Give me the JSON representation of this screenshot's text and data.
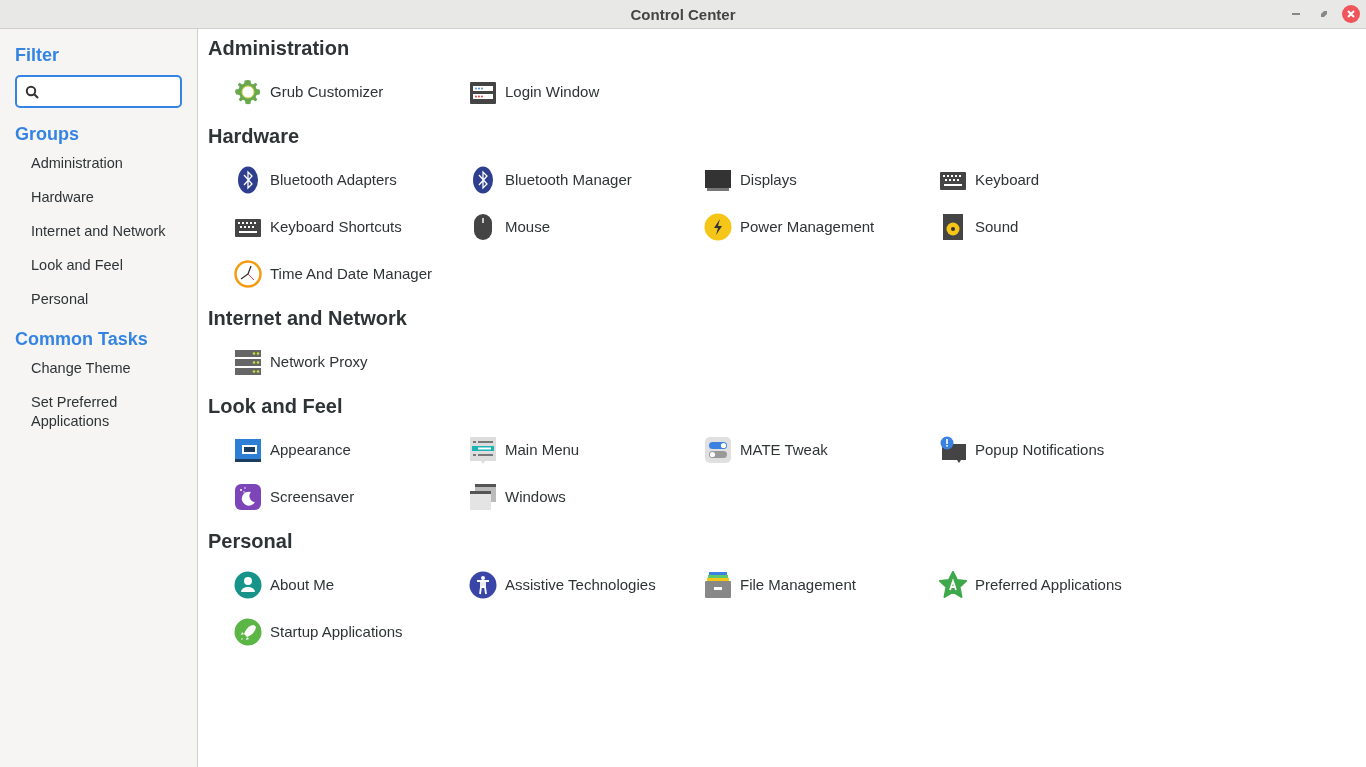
{
  "window": {
    "title": "Control Center"
  },
  "sidebar": {
    "filter_heading": "Filter",
    "groups_heading": "Groups",
    "groups": [
      "Administration",
      "Hardware",
      "Internet and Network",
      "Look and Feel",
      "Personal"
    ],
    "tasks_heading": "Common Tasks",
    "tasks": [
      "Change Theme",
      "Set Preferred Applications"
    ]
  },
  "sections": [
    {
      "title": "Administration",
      "items": [
        {
          "label": "Grub Customizer",
          "kind": "gear"
        },
        {
          "label": "Login Window",
          "kind": "login"
        }
      ]
    },
    {
      "title": "Hardware",
      "items": [
        {
          "label": "Bluetooth Adapters",
          "kind": "bluetooth"
        },
        {
          "label": "Bluetooth Manager",
          "kind": "bluetooth"
        },
        {
          "label": "Displays",
          "kind": "monitor"
        },
        {
          "label": "Keyboard",
          "kind": "keyboard"
        },
        {
          "label": "Keyboard Shortcuts",
          "kind": "keyboard"
        },
        {
          "label": "Mouse",
          "kind": "mouse"
        },
        {
          "label": "Power Management",
          "kind": "power"
        },
        {
          "label": "Sound",
          "kind": "speaker"
        },
        {
          "label": "Time And Date Manager",
          "kind": "clock"
        }
      ]
    },
    {
      "title": "Internet and Network",
      "items": [
        {
          "label": "Network Proxy",
          "kind": "server"
        }
      ]
    },
    {
      "title": "Look and Feel",
      "items": [
        {
          "label": "Appearance",
          "kind": "appearance"
        },
        {
          "label": "Main Menu",
          "kind": "menu"
        },
        {
          "label": "MATE Tweak",
          "kind": "toggles"
        },
        {
          "label": "Popup Notifications",
          "kind": "notification"
        },
        {
          "label": "Screensaver",
          "kind": "moon"
        },
        {
          "label": "Windows",
          "kind": "windows"
        }
      ]
    },
    {
      "title": "Personal",
      "items": [
        {
          "label": "About Me",
          "kind": "person"
        },
        {
          "label": "Assistive Technologies",
          "kind": "accessibility"
        },
        {
          "label": "File Management",
          "kind": "cabinet"
        },
        {
          "label": "Preferred Applications",
          "kind": "star"
        },
        {
          "label": "Startup Applications",
          "kind": "rocket"
        }
      ]
    }
  ]
}
